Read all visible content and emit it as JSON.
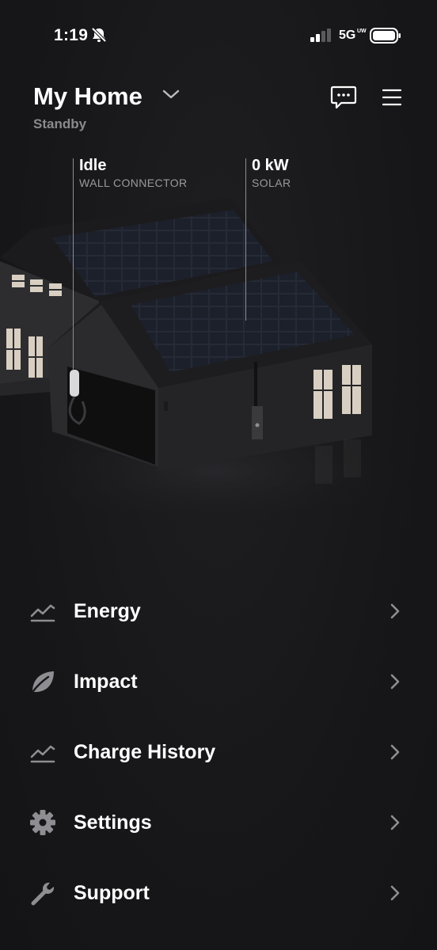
{
  "status_bar": {
    "time": "1:19",
    "network": "5G",
    "network_sub": "UW",
    "icons": [
      "bell-slash-icon",
      "signal-icon",
      "battery-icon"
    ]
  },
  "header": {
    "title": "My Home",
    "status": "Standby",
    "icons": [
      "chevron-down-icon",
      "chat-icon",
      "hamburger-menu-icon"
    ]
  },
  "callouts": {
    "wall_connector": {
      "value": "Idle",
      "label": "WALL CONNECTOR"
    },
    "solar": {
      "value": "0 kW",
      "label": "SOLAR"
    }
  },
  "menu": {
    "items": [
      {
        "label": "Energy",
        "icon": "line-chart-icon"
      },
      {
        "label": "Impact",
        "icon": "leaf-icon"
      },
      {
        "label": "Charge History",
        "icon": "line-chart-icon"
      },
      {
        "label": "Settings",
        "icon": "gear-icon"
      },
      {
        "label": "Support",
        "icon": "wrench-icon"
      }
    ]
  },
  "colors": {
    "background": "#171719",
    "text_primary": "#ffffff",
    "text_secondary": "#8a8a8e",
    "icon_gray": "#8e8e92"
  }
}
